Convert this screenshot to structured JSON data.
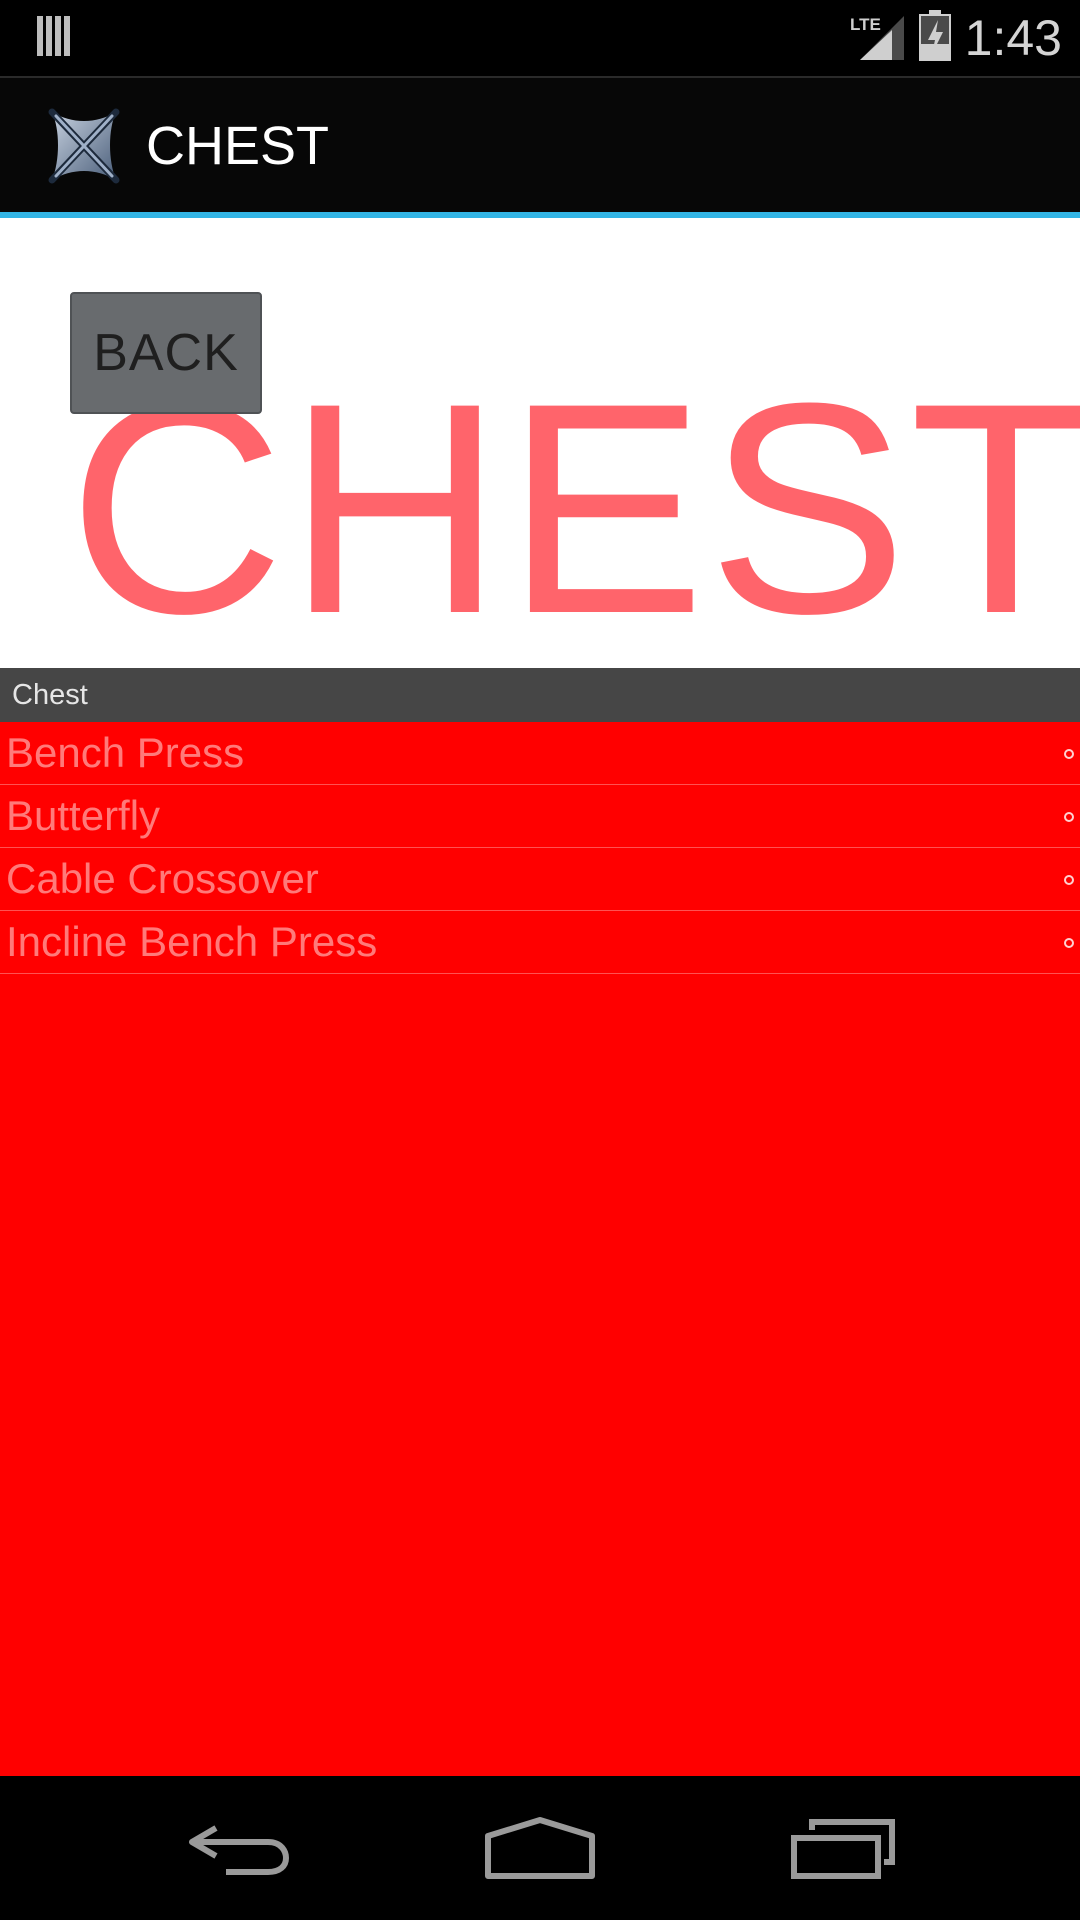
{
  "status_bar": {
    "time": "1:43",
    "network": "LTE",
    "icons": [
      "notification-icon",
      "signal-icon",
      "battery-charging-icon"
    ]
  },
  "action_bar": {
    "title": "CHEST",
    "logo_icon": "app-logo-icon"
  },
  "header": {
    "back_label": "BACK",
    "big_title": "CHEST",
    "title_color": "#ff2832"
  },
  "list": {
    "section_title": "Chest",
    "background_color": "#ff0000",
    "items": [
      {
        "label": "Bench Press"
      },
      {
        "label": "Butterfly"
      },
      {
        "label": "Cable Crossover"
      },
      {
        "label": "Incline Bench Press"
      }
    ]
  },
  "nav_bar": {
    "icons": [
      "back-nav-icon",
      "home-nav-icon",
      "recents-nav-icon"
    ]
  },
  "colors": {
    "accent": "#33b5e5",
    "section_header": "#464646"
  }
}
